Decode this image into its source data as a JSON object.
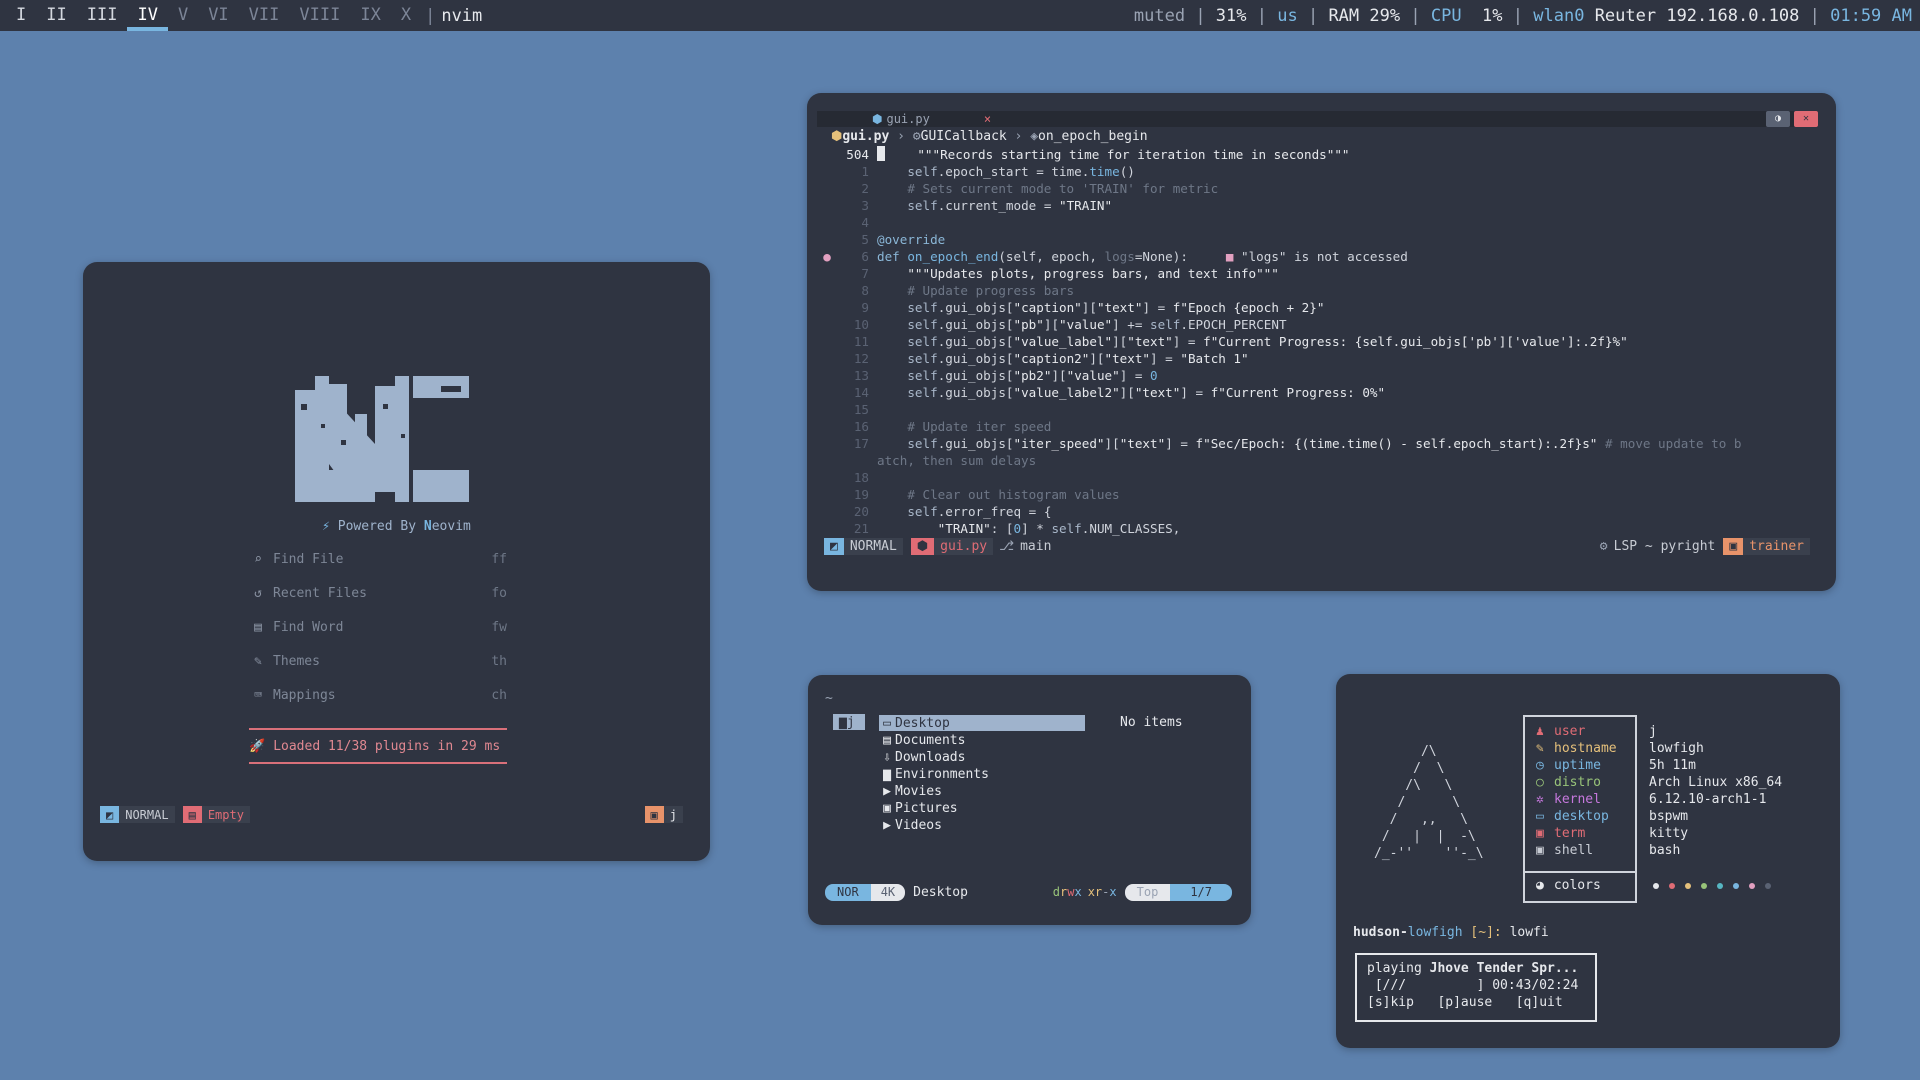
{
  "bar": {
    "workspaces": [
      {
        "label": "I",
        "state": "occupied"
      },
      {
        "label": "II",
        "state": "occupied"
      },
      {
        "label": "III",
        "state": "occupied"
      },
      {
        "label": "IV",
        "state": "active"
      },
      {
        "label": "V",
        "state": "empty"
      },
      {
        "label": "VI",
        "state": "empty"
      },
      {
        "label": "VII",
        "state": "empty"
      },
      {
        "label": "VIII",
        "state": "empty"
      },
      {
        "label": "IX",
        "state": "empty"
      },
      {
        "label": "X",
        "state": "empty"
      }
    ],
    "separator": "|",
    "window_title": "nvim",
    "volume": "muted",
    "battery": "31%",
    "keyboard": "us",
    "ram_label": "RAM",
    "ram_value": "29%",
    "cpu_label": "CPU",
    "cpu_value": "1%",
    "network_iface": "wlan0",
    "network_name": "Reuter 192.168.0.108",
    "clock": "01:59 AM",
    "accent": "#79b6e0"
  },
  "dashboard": {
    "powered_prefix": "Powered By",
    "powered_name": "eovim",
    "menu": [
      {
        "icon": "search-icon",
        "label": "Find File",
        "key": "ff"
      },
      {
        "icon": "history-icon",
        "label": "Recent Files",
        "key": "fo"
      },
      {
        "icon": "document-icon",
        "label": "Find Word",
        "key": "fw"
      },
      {
        "icon": "brush-icon",
        "label": "Themes",
        "key": "th"
      },
      {
        "icon": "keyboard-icon",
        "label": "Mappings",
        "key": "ch"
      }
    ],
    "loaded": "Loaded 11/38 plugins in 29 ms",
    "status": {
      "mode": "NORMAL",
      "file": "Empty",
      "dir": "j"
    }
  },
  "editor": {
    "tab": "gui.py",
    "tab_close": "×",
    "breadcrumb": {
      "file": "gui.py",
      "class": "GUICallback",
      "method": "on_epoch_begin"
    },
    "lines": [
      {
        "num": "504",
        "cur": true,
        "html": "<span class='s'>    \"\"\"Records starting time for iteration time in seconds\"\"\"</span>"
      },
      {
        "num": "1",
        "html": "    <span class='d'>self</span>.epoch_start = time.<span class='f'>time</span>()"
      },
      {
        "num": "2",
        "html": "<span class='c'>    # Sets current mode to 'TRAIN' for metric</span>"
      },
      {
        "num": "3",
        "html": "    <span class='d'>self</span>.current_mode = <span class='s'>\"TRAIN\"</span>"
      },
      {
        "num": "4",
        "html": ""
      },
      {
        "num": "5",
        "html": "<span class='k'>@override</span>"
      },
      {
        "num": "6",
        "gut": "●",
        "html": "<span class='k'>def</span> <span class='f'>on_epoch_end</span>(self, epoch, <span class='c'>logs</span>=None):     <span style='color:#e2a0c0'>■</span> \"logs\" is not accessed"
      },
      {
        "num": "7",
        "html": "<span class='s'>    \"\"\"Updates plots, progress bars, and text info\"\"\"</span>"
      },
      {
        "num": "8",
        "html": "<span class='c'>    # Update progress bars</span>"
      },
      {
        "num": "9",
        "html": "    <span class='d'>self</span>.gui_objs[<span class='s'>\"caption\"</span>][<span class='s'>\"text\"</span>] = <span class='s'>f\"Epoch {epoch + 2}\"</span>"
      },
      {
        "num": "10",
        "html": "    <span class='d'>self</span>.gui_objs[<span class='s'>\"pb\"</span>][<span class='s'>\"value\"</span>] += <span class='d'>self</span>.EPOCH_PERCENT"
      },
      {
        "num": "11",
        "html": "    <span class='d'>self</span>.gui_objs[<span class='s'>\"value_label\"</span>][<span class='s'>\"text\"</span>] = <span class='s'>f\"Current Progress: {self.gui_objs['pb']['value']:.2f}%\"</span>"
      },
      {
        "num": "12",
        "html": "    <span class='d'>self</span>.gui_objs[<span class='s'>\"caption2\"</span>][<span class='s'>\"text\"</span>] = <span class='s'>\"Batch 1\"</span>"
      },
      {
        "num": "13",
        "html": "    <span class='d'>self</span>.gui_objs[<span class='s'>\"pb2\"</span>][<span class='s'>\"value\"</span>] = <span class='f'>0</span>"
      },
      {
        "num": "14",
        "html": "    <span class='d'>self</span>.gui_objs[<span class='s'>\"value_label2\"</span>][<span class='s'>\"text\"</span>] = <span class='s'>f\"Current Progress: 0%\"</span>"
      },
      {
        "num": "15",
        "html": ""
      },
      {
        "num": "16",
        "html": "<span class='c'>    # Update iter speed</span>"
      },
      {
        "num": "17",
        "html": "    <span class='d'>self</span>.gui_objs[<span class='s'>\"iter_speed\"</span>][<span class='s'>\"text\"</span>] = <span class='s'>f\"Sec/Epoch: {(time.time() - self.epoch_start):.2f}s\"</span> <span class='c'># move update to b</span>"
      },
      {
        "num": "",
        "html": "<span class='c'>atch, then sum delays</span>"
      },
      {
        "num": "18",
        "html": ""
      },
      {
        "num": "19",
        "html": "<span class='c'>    # Clear out histogram values</span>"
      },
      {
        "num": "20",
        "html": "    <span class='d'>self</span>.error_freq = {"
      },
      {
        "num": "21",
        "html": "        <span class='s'>\"TRAIN\"</span>: [<span class='f'>0</span>] * <span class='d'>self</span>.NUM_CLASSES,"
      }
    ],
    "status": {
      "mode": "NORMAL",
      "file": "gui.py",
      "branch": "main",
      "lsp": "LSP ~ pyright",
      "dir": "trainer"
    }
  },
  "filemanager": {
    "path": "~",
    "parent": "j",
    "items": [
      "Desktop",
      "Documents",
      "Downloads",
      "Environments",
      "Movies",
      "Pictures",
      "Videos"
    ],
    "selected": "Desktop",
    "preview": "No items",
    "status": {
      "mode": "NOR",
      "size": "4K",
      "name": "Desktop",
      "perms_d": "d",
      "perms_r": "r",
      "perms_w": "w",
      "perms_x1": "x",
      "perms_rest": "r-x",
      "perms_x2": "r-x",
      "pos_label": "Top",
      "pos": "1/7"
    }
  },
  "fetch": {
    "labels": [
      {
        "icon": "user-icon",
        "label": "user",
        "value": "j",
        "color": "#e06c75"
      },
      {
        "icon": "pen-icon",
        "label": "hostname",
        "value": "lowfigh",
        "color": "#e5c07b"
      },
      {
        "icon": "clock-icon",
        "label": "uptime",
        "value": "5h 11m",
        "color": "#79b6e0"
      },
      {
        "icon": "circle-icon",
        "label": "distro",
        "value": "Arch Linux x86_64",
        "color": "#98c379"
      },
      {
        "icon": "gear-icon",
        "label": "kernel",
        "value": "6.12.10-arch1-1",
        "color": "#c678dd"
      },
      {
        "icon": "monitor-icon",
        "label": "desktop",
        "value": "bspwm",
        "color": "#79b6e0"
      },
      {
        "icon": "terminal-icon",
        "label": "term",
        "value": "kitty",
        "color": "#e06c75"
      },
      {
        "icon": "terminal-icon",
        "label": "shell",
        "value": "bash",
        "color": "#c8ccd4"
      }
    ],
    "colors_label": "colors",
    "palette": [
      "#e6e8ec",
      "#e06c75",
      "#e5c07b",
      "#98c379",
      "#56b6c2",
      "#79b6e0",
      "#e2a0c0",
      "#5a6273"
    ],
    "prompt": {
      "user": "hudson",
      "host": "lowfigh",
      "dir": "[~]:",
      "cmd": "lowfi"
    },
    "music": {
      "playing": "playing",
      "track": "Jhove Tender Spr...",
      "bar": " [///         ] 00:43/02:24",
      "skip": "[s]kip",
      "pause": "[p]ause",
      "quit": "[q]uit"
    }
  }
}
